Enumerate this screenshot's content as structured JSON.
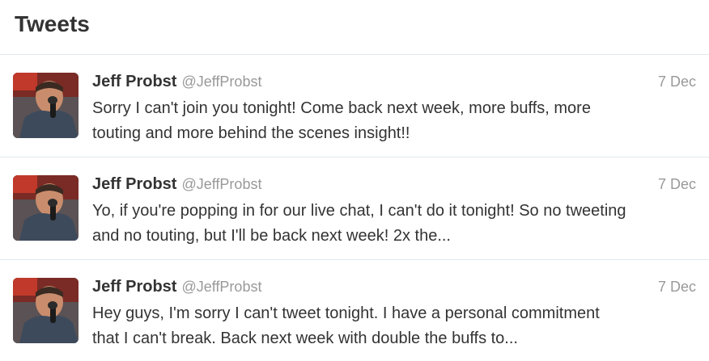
{
  "header": {
    "title": "Tweets"
  },
  "tweets": [
    {
      "fullname": "Jeff Probst",
      "username": "@JeffProbst",
      "time": "7 Dec",
      "text_line1": "Sorry I can't join you tonight! Come back next week, more buffs, more",
      "text_line2": "touting and more behind the scenes insight!!"
    },
    {
      "fullname": "Jeff Probst",
      "username": "@JeffProbst",
      "time": "7 Dec",
      "text_line1": "Yo, if you're popping in for our live chat, I can't do it tonight! So no tweeting",
      "text_line2": "and no touting, but I'll be back next week! 2x the..."
    },
    {
      "fullname": "Jeff Probst",
      "username": "@JeffProbst",
      "time": "7 Dec",
      "text_line1": "Hey guys, I'm sorry I can't tweet tonight. I have a personal commitment",
      "text_line2": "that I can't break. Back next week with double the buffs to..."
    }
  ]
}
